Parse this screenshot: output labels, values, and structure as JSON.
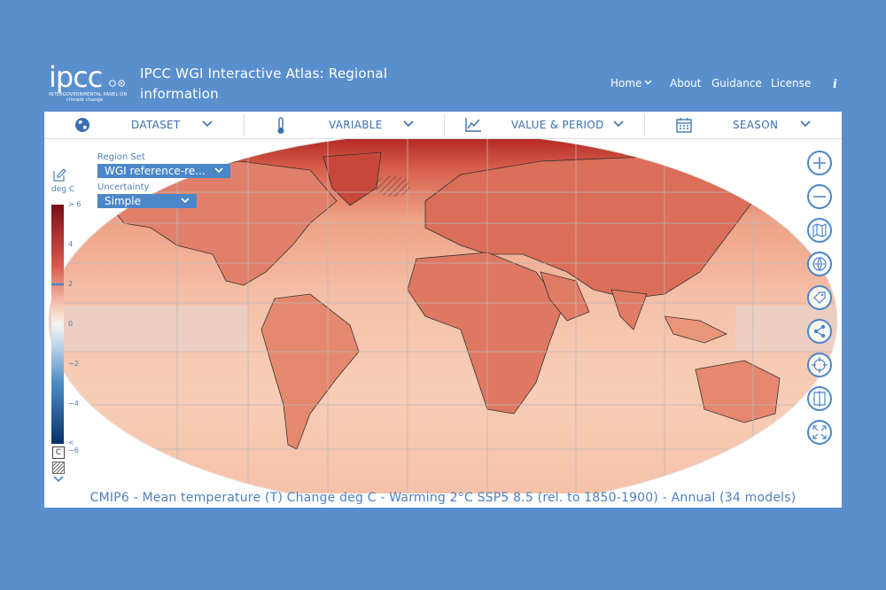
{
  "header": {
    "logo_word": "ipcc",
    "logo_sub_1": "INTERGOVERNMENTAL PANEL ON",
    "logo_sub_2": "climate change",
    "title": "IPCC WGI Interactive Atlas: Regional information",
    "nav": {
      "home": "Home",
      "about": "About",
      "guidance": "Guidance",
      "license": "License",
      "info": "i"
    }
  },
  "toolbar": {
    "dataset": "DATASET",
    "variable": "VARIABLE",
    "value_period": "VALUE & PERIOD",
    "season": "SEASON"
  },
  "controls": {
    "region_set_label": "Region Set",
    "region_set_value": "WGI reference-re...",
    "uncertainty_label": "Uncertainty",
    "uncertainty_value": "Simple"
  },
  "legend": {
    "unit": "deg C",
    "ticks": {
      "max": "> 6",
      "t4": "4",
      "t2": "2",
      "t0": "0",
      "tm2": "−2",
      "tm4": "−4",
      "min": "< −6"
    },
    "contour_box": "C",
    "current_level": 2
  },
  "caption": "CMIP6 - Mean temperature (T) Change deg C - Warming 2°C SSP5 8.5 (rel. to 1850-1900) - Annual (34 models)",
  "tools": [
    "zoom-in-icon",
    "zoom-out-icon",
    "map-layers-icon",
    "globe-icon",
    "label-icon",
    "share-icon",
    "locate-icon",
    "compare-icon",
    "fullscreen-icon"
  ],
  "colors": {
    "background": "#5a8fce",
    "accent": "#4a86c8",
    "hot": "#c9302c",
    "warm": "#f4a386"
  }
}
